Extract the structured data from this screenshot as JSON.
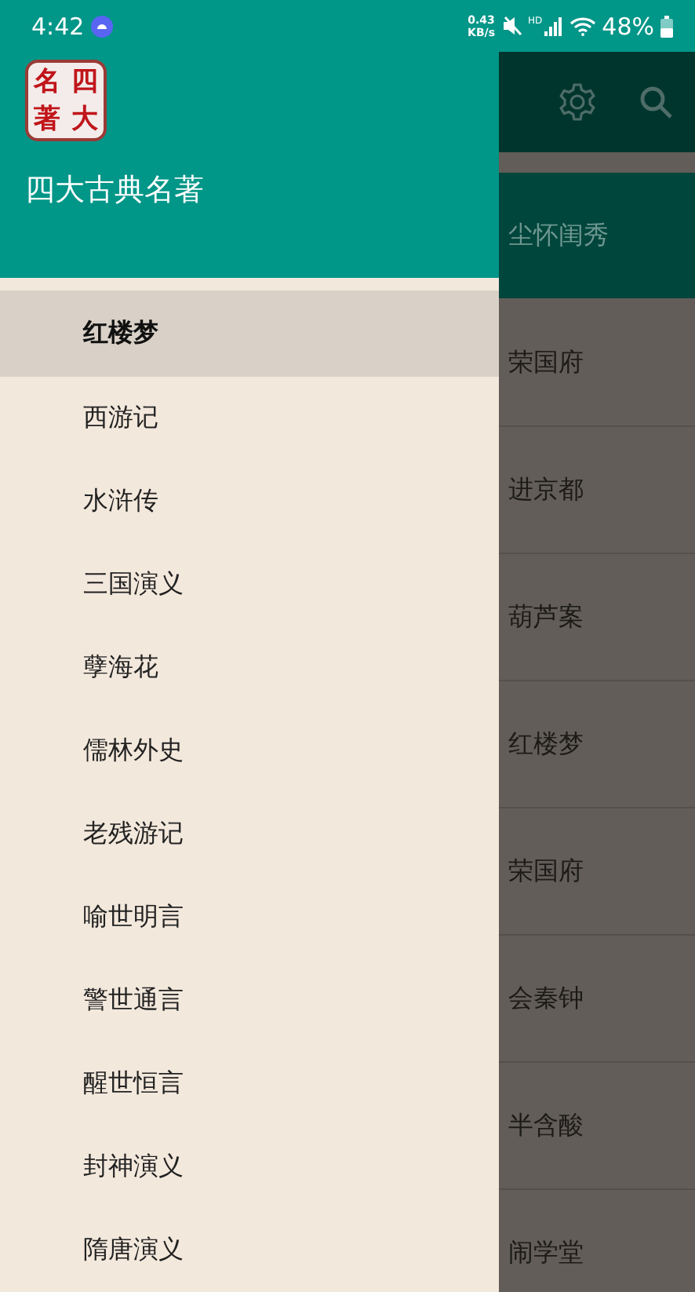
{
  "status_bar": {
    "time": "4:42",
    "speed_value": "0.43",
    "speed_unit": "KB/s",
    "signal_label": "HD",
    "battery": "48%"
  },
  "drawer": {
    "logo_chars": [
      "名",
      "四",
      "著",
      "大"
    ],
    "title": "四大古典名著",
    "items": [
      {
        "label": "红楼梦",
        "selected": true
      },
      {
        "label": "西游记",
        "selected": false
      },
      {
        "label": "水浒传",
        "selected": false
      },
      {
        "label": "三国演义",
        "selected": false
      },
      {
        "label": "孽海花",
        "selected": false
      },
      {
        "label": "儒林外史",
        "selected": false
      },
      {
        "label": "老残游记",
        "selected": false
      },
      {
        "label": "喻世明言",
        "selected": false
      },
      {
        "label": "警世通言",
        "selected": false
      },
      {
        "label": "醒世恒言",
        "selected": false
      },
      {
        "label": "封神演义",
        "selected": false
      },
      {
        "label": "隋唐演义",
        "selected": false
      }
    ]
  },
  "chapters": [
    {
      "title": "尘怀闺秀",
      "selected": true
    },
    {
      "title": "荣国府",
      "selected": false
    },
    {
      "title": "进京都",
      "selected": false
    },
    {
      "title": "葫芦案",
      "selected": false
    },
    {
      "title": "红楼梦",
      "selected": false
    },
    {
      "title": "荣国府",
      "selected": false
    },
    {
      "title": "会秦钟",
      "selected": false
    },
    {
      "title": "半含酸",
      "selected": false
    },
    {
      "title": "闹学堂",
      "selected": false
    }
  ]
}
